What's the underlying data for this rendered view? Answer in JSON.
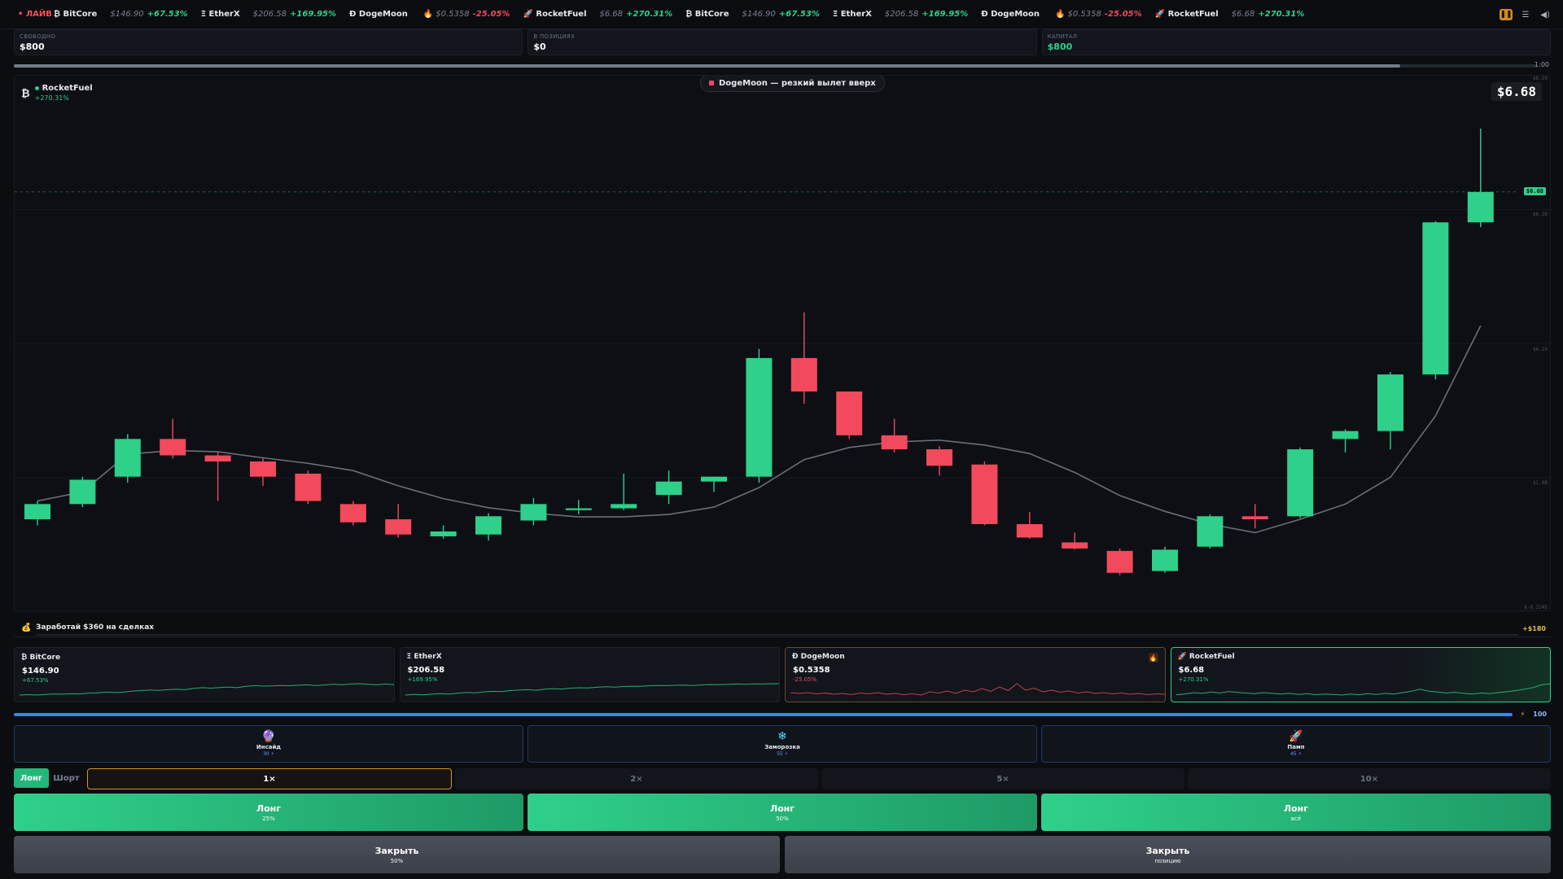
{
  "ticker": {
    "live_label": "• ЛАЙВ",
    "items": [
      {
        "glyph": "₿",
        "name": "BitCore",
        "price": "$146.90",
        "change": "+67.53%",
        "dir": "up",
        "hot": false
      },
      {
        "glyph": "Ξ",
        "name": "EtherX",
        "price": "$206.58",
        "change": "+169.95%",
        "dir": "up",
        "hot": false
      },
      {
        "glyph": "Ð",
        "name": "DogeMoon",
        "price": "$0.5358",
        "change": "-25.05%",
        "dir": "down",
        "hot": true
      },
      {
        "glyph": "🚀",
        "name": "RocketFuel",
        "price": "$6.68",
        "change": "+270.31%",
        "dir": "up",
        "hot": false
      },
      {
        "glyph": "₿",
        "name": "BitCore",
        "price": "$146.90",
        "change": "+67.53%",
        "dir": "up",
        "hot": false
      },
      {
        "glyph": "Ξ",
        "name": "EtherX",
        "price": "$206.58",
        "change": "+169.95%",
        "dir": "up",
        "hot": false
      },
      {
        "glyph": "Ð",
        "name": "DogeMoon",
        "price": "$0.5358",
        "change": "-25.05%",
        "dir": "down",
        "hot": true
      },
      {
        "glyph": "🚀",
        "name": "RocketFuel",
        "price": "$6.68",
        "change": "+270.31%",
        "dir": "up",
        "hot": false
      }
    ],
    "controls": [
      "pause-icon",
      "menu-icon",
      "sound-icon"
    ]
  },
  "balances": [
    {
      "label": "Свободно",
      "value": "$800",
      "accent": false
    },
    {
      "label": "В позициях",
      "value": "$0",
      "accent": false
    },
    {
      "label": "Капитал",
      "value": "$800",
      "accent": true
    }
  ],
  "timer": {
    "label": "1:00",
    "progress": 0.91
  },
  "chart": {
    "asset_glyph": "₿",
    "asset_name": "RocketFuel",
    "asset_change": "+270.31%",
    "event_text": "DogeMoon — резкий вылет вверх",
    "current_price": "$6.68",
    "price_tag": "$6.68",
    "y_labels": [
      "$8.59",
      "$6.39",
      "$4.19",
      "$1.98",
      "$-0.2245"
    ]
  },
  "chart_data": {
    "type": "candlestick",
    "ylim": [
      -0.2245,
      8.59
    ],
    "current": 6.68,
    "candles": [
      {
        "o": 1.3,
        "c": 1.55,
        "h": 1.6,
        "l": 1.2
      },
      {
        "o": 1.55,
        "c": 1.95,
        "h": 2.0,
        "l": 1.5
      },
      {
        "o": 2.0,
        "c": 2.62,
        "h": 2.7,
        "l": 1.9
      },
      {
        "o": 2.62,
        "c": 2.35,
        "h": 2.95,
        "l": 2.3
      },
      {
        "o": 2.35,
        "c": 2.25,
        "h": 2.4,
        "l": 1.6
      },
      {
        "o": 2.25,
        "c": 2.0,
        "h": 2.3,
        "l": 1.85
      },
      {
        "o": 2.05,
        "c": 1.6,
        "h": 2.1,
        "l": 1.55
      },
      {
        "o": 1.55,
        "c": 1.25,
        "h": 1.6,
        "l": 1.2
      },
      {
        "o": 1.3,
        "c": 1.05,
        "h": 1.55,
        "l": 1.0
      },
      {
        "o": 1.02,
        "c": 1.1,
        "h": 1.2,
        "l": 0.98
      },
      {
        "o": 1.05,
        "c": 1.35,
        "h": 1.4,
        "l": 0.95
      },
      {
        "o": 1.28,
        "c": 1.55,
        "h": 1.65,
        "l": 1.2
      },
      {
        "o": 1.45,
        "c": 1.48,
        "h": 1.62,
        "l": 1.38
      },
      {
        "o": 1.48,
        "c": 1.55,
        "h": 2.05,
        "l": 1.45
      },
      {
        "o": 1.7,
        "c": 1.92,
        "h": 2.1,
        "l": 1.55
      },
      {
        "o": 1.92,
        "c": 2.0,
        "h": 2.0,
        "l": 1.75
      },
      {
        "o": 2.0,
        "c": 3.95,
        "h": 4.1,
        "l": 1.9
      },
      {
        "o": 3.95,
        "c": 3.4,
        "h": 4.7,
        "l": 3.2
      },
      {
        "o": 3.4,
        "c": 2.68,
        "h": 3.4,
        "l": 2.62
      },
      {
        "o": 2.68,
        "c": 2.45,
        "h": 2.95,
        "l": 2.4
      },
      {
        "o": 2.45,
        "c": 2.18,
        "h": 2.5,
        "l": 2.02
      },
      {
        "o": 2.2,
        "c": 1.22,
        "h": 2.25,
        "l": 1.2
      },
      {
        "o": 1.22,
        "c": 1.0,
        "h": 1.42,
        "l": 0.98
      },
      {
        "o": 0.92,
        "c": 0.82,
        "h": 1.08,
        "l": 0.8
      },
      {
        "o": 0.78,
        "c": 0.42,
        "h": 0.82,
        "l": 0.38
      },
      {
        "o": 0.45,
        "c": 0.8,
        "h": 0.85,
        "l": 0.42
      },
      {
        "o": 0.85,
        "c": 1.35,
        "h": 1.38,
        "l": 0.82
      },
      {
        "o": 1.35,
        "c": 1.3,
        "h": 1.55,
        "l": 1.15
      },
      {
        "o": 1.35,
        "c": 2.45,
        "h": 2.48,
        "l": 1.32
      },
      {
        "o": 2.62,
        "c": 2.75,
        "h": 2.78,
        "l": 2.4
      },
      {
        "o": 2.75,
        "c": 3.68,
        "h": 3.72,
        "l": 2.45
      },
      {
        "o": 3.68,
        "c": 6.18,
        "h": 6.2,
        "l": 3.6
      },
      {
        "o": 6.18,
        "c": 6.68,
        "h": 7.72,
        "l": 6.1
      }
    ],
    "ma": [
      1.6,
      1.75,
      2.37,
      2.43,
      2.41,
      2.31,
      2.22,
      2.1,
      1.85,
      1.64,
      1.49,
      1.4,
      1.34,
      1.34,
      1.38,
      1.5,
      1.82,
      2.28,
      2.48,
      2.57,
      2.6,
      2.52,
      2.38,
      2.07,
      1.69,
      1.43,
      1.22,
      1.08,
      1.3,
      1.55,
      1.99,
      3.0,
      4.48
    ]
  },
  "mission": {
    "text": "Заработай $360 на сделках",
    "reward": "+$180",
    "progress": 0.0
  },
  "asset_cards": [
    {
      "glyph": "₿",
      "name": "BitCore",
      "price": "$146.90",
      "change": "+67.53%",
      "dir": "up",
      "hot": false,
      "active": false,
      "spark": [
        4,
        4.2,
        4,
        4.3,
        4.5,
        4.4,
        4.6,
        4.5,
        4.9,
        5,
        5.3,
        5.1,
        5.4,
        5.8,
        6,
        6.3,
        6.1,
        6.4,
        6.6,
        6.4,
        7,
        7.3,
        7.1,
        7.4,
        7.6,
        7.3,
        7.9,
        8.2,
        8,
        8.1,
        8.3,
        8.2,
        8.4,
        8.6,
        8.3,
        8.5,
        8.8,
        8.6,
        8.9,
        9.1,
        8.8,
        8.6,
        8.9,
        8.7
      ]
    },
    {
      "glyph": "Ξ",
      "name": "EtherX",
      "price": "$206.58",
      "change": "+169.95%",
      "dir": "up",
      "hot": false,
      "active": false,
      "spark": [
        3,
        3.3,
        3.1,
        3.5,
        3.8,
        3.6,
        4,
        4.4,
        4.2,
        4.8,
        5.1,
        4.9,
        5.5,
        5.8,
        6,
        5.7,
        6.3,
        6.6,
        6.4,
        6.9,
        7.1,
        7,
        7.4,
        7.7,
        7.5,
        7.8,
        8,
        7.9,
        8.2,
        8.4,
        8.3,
        8.5,
        8.6,
        8.4,
        8.7,
        8.9,
        8.8,
        9,
        9.2,
        9.1,
        9.3,
        9.2,
        9.4,
        9.3
      ]
    },
    {
      "glyph": "Ð",
      "name": "DogeMoon",
      "price": "$0.5358",
      "change": "-25.05%",
      "dir": "down",
      "hot": true,
      "active": false,
      "spark": [
        7,
        6.8,
        7,
        6.7,
        6.9,
        6.6,
        6.8,
        6.5,
        6.9,
        6.7,
        7,
        6.6,
        6.8,
        6.5,
        6.7,
        6.4,
        7.2,
        6.9,
        7.4,
        6.8,
        7.6,
        7.2,
        8,
        7.3,
        8.4,
        7.5,
        9.2,
        7.6,
        8.1,
        7.2,
        7.6,
        7.1,
        7.4,
        6.9,
        7.2,
        6.8,
        7,
        6.7,
        6.9,
        6.6,
        6.8,
        6.5,
        6.7,
        6.6
      ]
    },
    {
      "glyph": "🚀",
      "name": "RocketFuel",
      "price": "$6.68",
      "change": "+270.31%",
      "dir": "up",
      "hot": false,
      "active": true,
      "spark": [
        6,
        6.2,
        6.6,
        6.4,
        6.8,
        6.5,
        6.9,
        6.7,
        6.5,
        6.3,
        6.6,
        6.4,
        6.2,
        6.4,
        6.1,
        6.3,
        6,
        6.2,
        6.1,
        5.9,
        6.2,
        6,
        6.3,
        6.1,
        6.4,
        6.2,
        6.6,
        7,
        7.6,
        7,
        6.8,
        6.5,
        6.7,
        6.4,
        6.2,
        6.5,
        6.3,
        6.6,
        6.9,
        7.2,
        7.6,
        8.1,
        8.9,
        9.2
      ]
    }
  ],
  "energy": {
    "value": "100",
    "progress": 0.99
  },
  "powers": [
    {
      "icon": "🔮",
      "icon_name": "crystal-ball-icon",
      "name": "Инсайд",
      "cost": "30 ⚡"
    },
    {
      "icon": "❄",
      "icon_name": "snowflake-icon",
      "name": "Заморозка",
      "cost": "55 ⚡"
    },
    {
      "icon": "🚀",
      "icon_name": "rocket-icon",
      "name": "Памп",
      "cost": "45 ⚡"
    }
  ],
  "side": {
    "long": "Лонг",
    "short": "Шорт",
    "selected": "long"
  },
  "leverage": {
    "options": [
      "1×",
      "2×",
      "5×",
      "10×"
    ],
    "selected": 0
  },
  "actions": [
    {
      "title": "Лонг",
      "sub": "25%"
    },
    {
      "title": "Лонг",
      "sub": "50%"
    },
    {
      "title": "Лонг",
      "sub": "всё"
    }
  ],
  "closes": [
    {
      "title": "Закрыть",
      "sub": "50%"
    },
    {
      "title": "Закрыть",
      "sub": "позицию"
    }
  ],
  "colors": {
    "up": "#2fd08a",
    "down": "#f2495c",
    "accent": "#3b82f6",
    "warn": "#d99326"
  }
}
